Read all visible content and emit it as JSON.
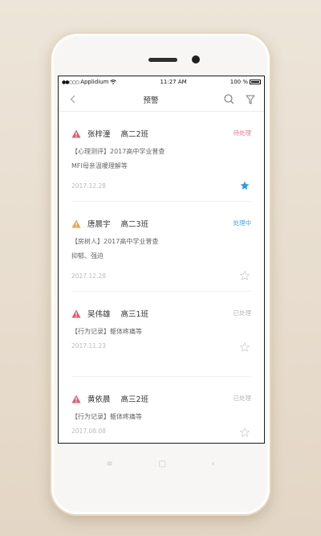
{
  "status_bar": {
    "carrier": "Applidium",
    "time": "11:27 AM",
    "battery": "100 %"
  },
  "nav": {
    "title": "预警"
  },
  "colors": {
    "red": "#e8566f",
    "orange": "#f0a042",
    "pending": "#f07890",
    "processing": "#3aa8e8",
    "done": "#b5b5b5",
    "star_active": "#2e9be6"
  },
  "alerts": [
    {
      "name": "张梓潼",
      "class": "高二2班",
      "status": "待处理",
      "status_type": "pending",
      "level": "red",
      "lines": [
        "【心理测评】2017高中学业普查",
        "MFI母亲温暖理解等"
      ],
      "date": "2017.12.28",
      "starred": true
    },
    {
      "name": "唐晨宇",
      "class": "高二3班",
      "status": "处理中",
      "status_type": "processing",
      "level": "orange",
      "lines": [
        "【房树人】2017高中学业普查",
        "抑郁、强迫"
      ],
      "date": "2017.12.28",
      "starred": false
    },
    {
      "name": "吴伟雄",
      "class": "高三1班",
      "status": "已处理",
      "status_type": "done",
      "level": "red",
      "lines": [
        "【行为记录】躯体疼痛等"
      ],
      "date": "2017.11.23",
      "starred": false
    },
    {
      "name": "黄依晨",
      "class": "高三2班",
      "status": "已处理",
      "status_type": "done",
      "level": "red",
      "lines": [
        "【行为记录】躯体疼痛等"
      ],
      "date": "2017.08.08",
      "starred": false
    }
  ]
}
